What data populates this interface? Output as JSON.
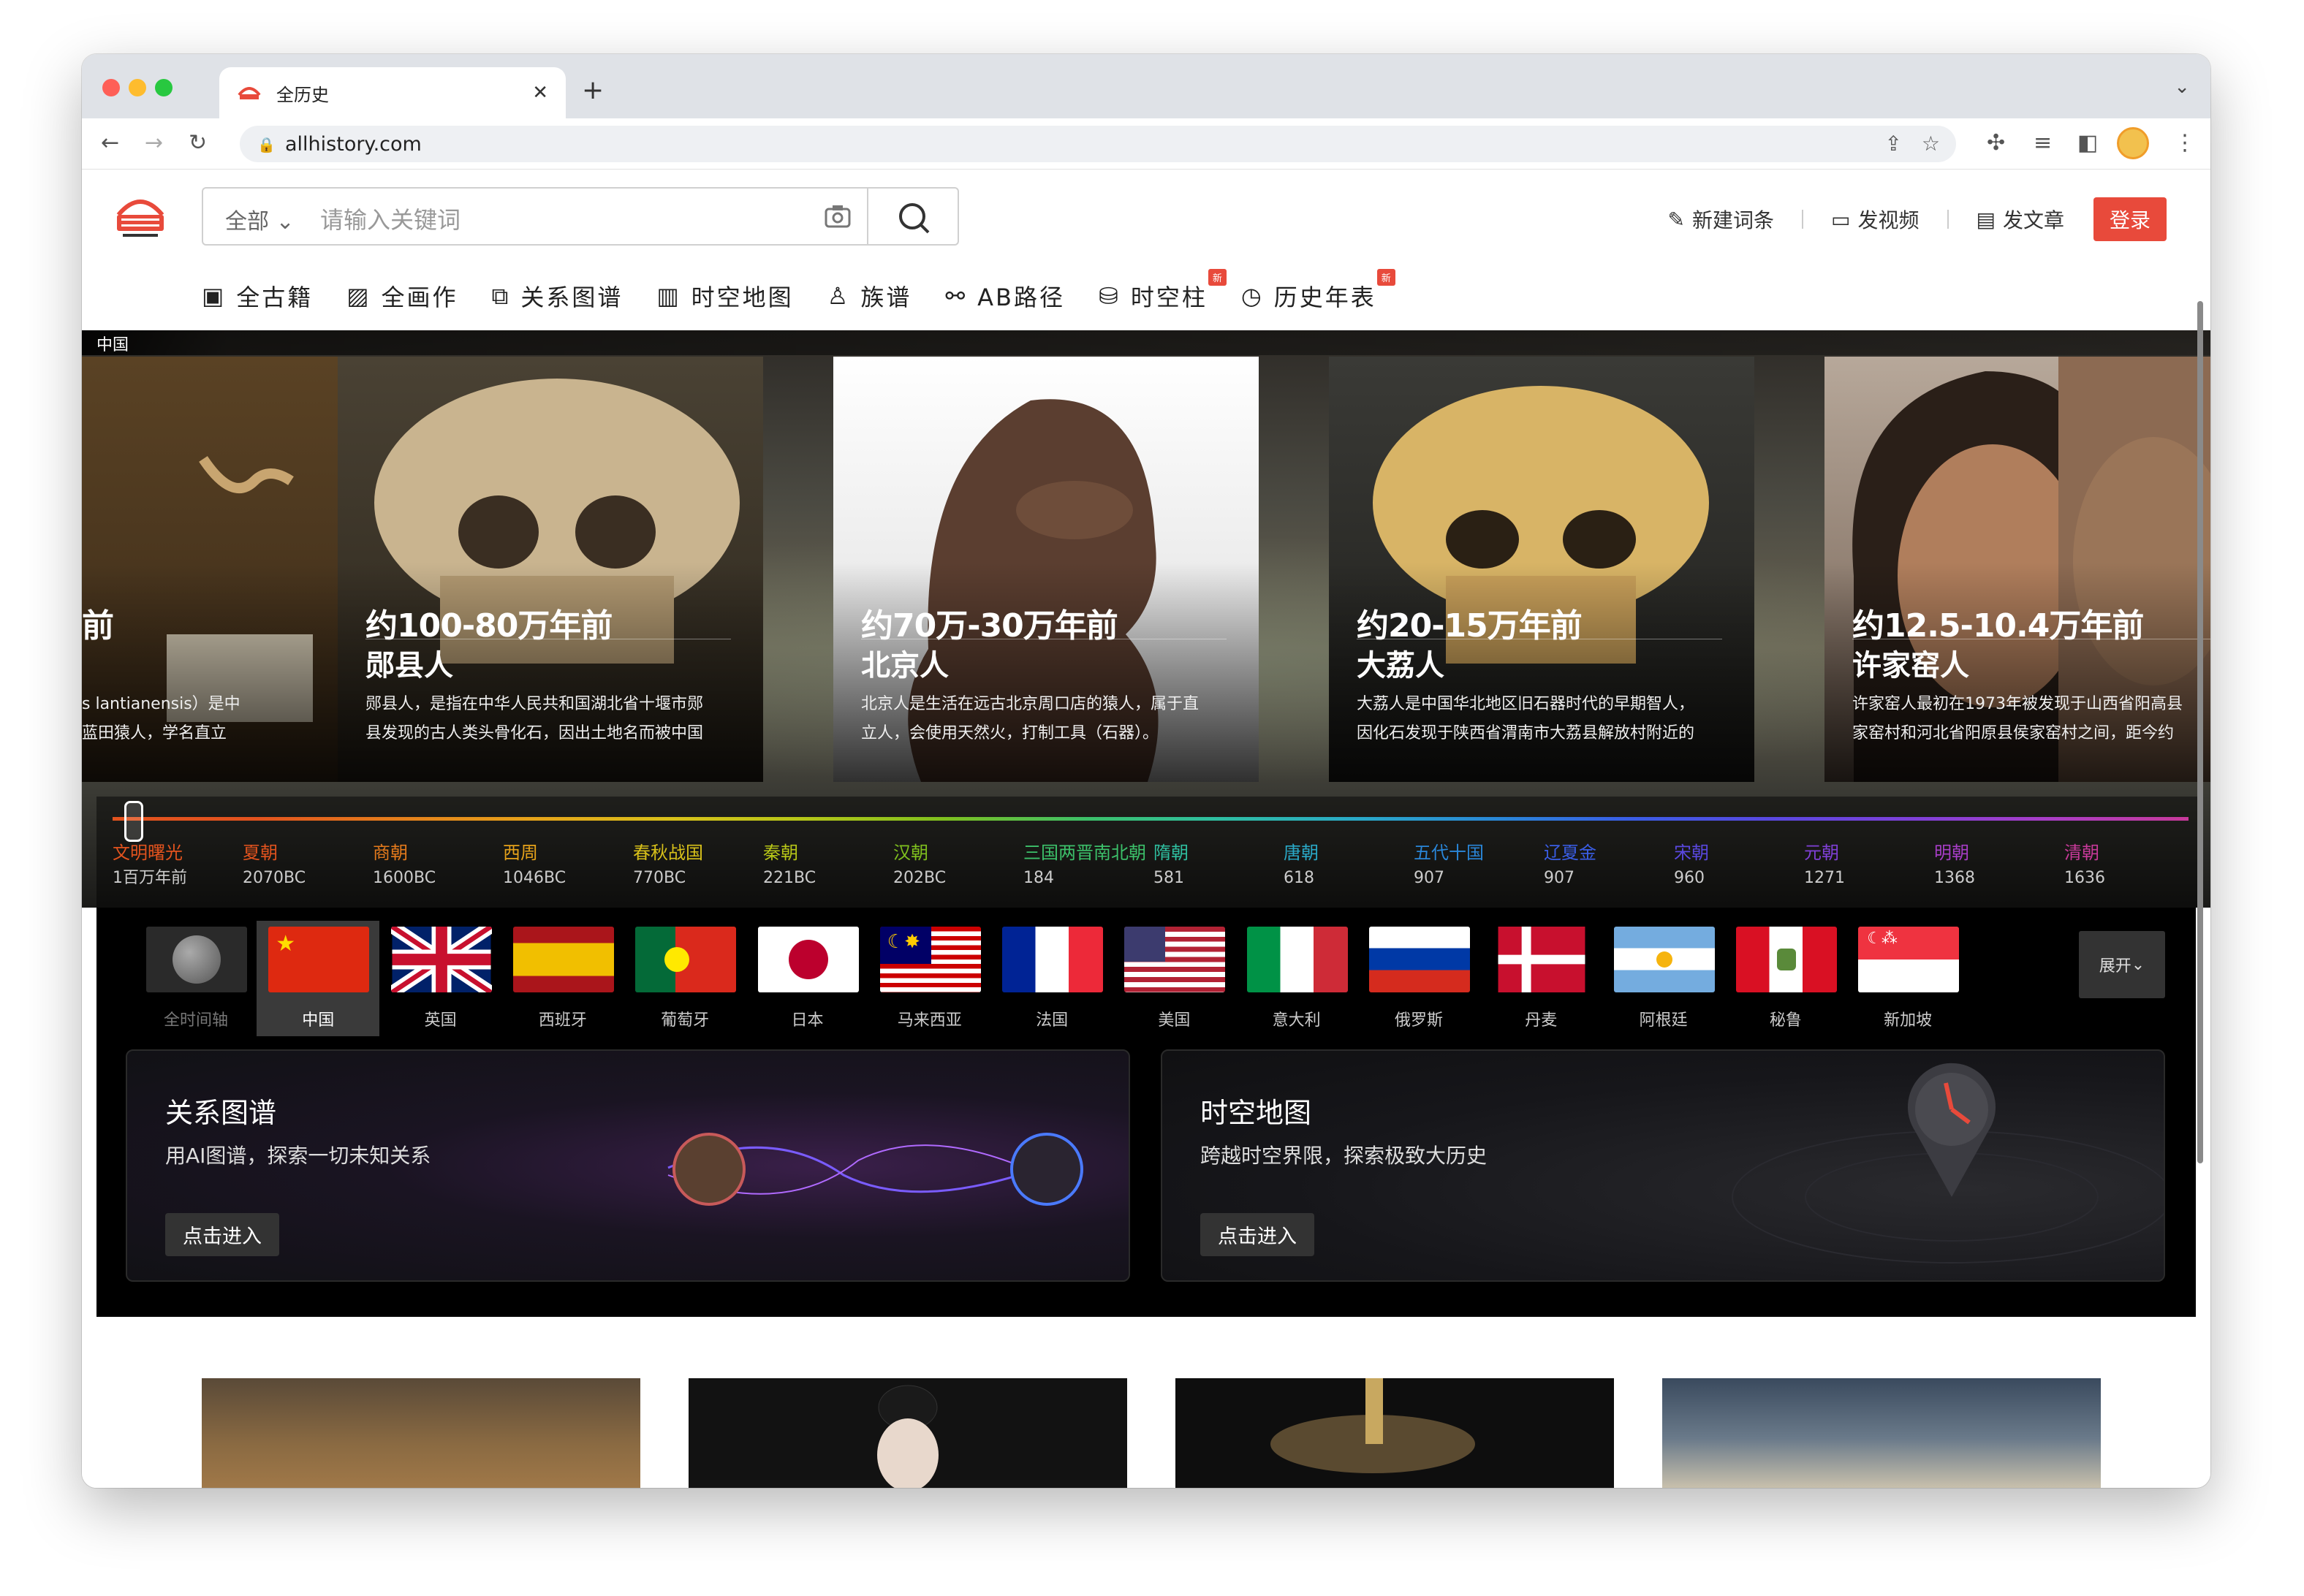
{
  "browser": {
    "tab_title": "全历史",
    "tab_close": "✕",
    "new_tab": "+",
    "url": "allhistory.com"
  },
  "header": {
    "search_scope": "全部",
    "search_placeholder": "请输入关键词",
    "actions": [
      {
        "label": "新建词条",
        "icon": "edit-icon"
      },
      {
        "label": "发视频",
        "icon": "video-icon"
      },
      {
        "label": "发文章",
        "icon": "article-icon"
      }
    ],
    "login": "登录"
  },
  "subnav": [
    {
      "label": "全古籍",
      "icon": "book-icon",
      "badge": ""
    },
    {
      "label": "全画作",
      "icon": "painting-icon",
      "badge": ""
    },
    {
      "label": "关系图谱",
      "icon": "graph-icon",
      "badge": ""
    },
    {
      "label": "时空地图",
      "icon": "map-icon",
      "badge": ""
    },
    {
      "label": "族谱",
      "icon": "family-icon",
      "badge": ""
    },
    {
      "label": "AB路径",
      "icon": "path-icon",
      "badge": ""
    },
    {
      "label": "时空柱",
      "icon": "pillar-icon",
      "badge": "新"
    },
    {
      "label": "历史年表",
      "icon": "timeline-icon",
      "badge": "新"
    }
  ],
  "hero": {
    "country_label": "中国",
    "cards": [
      {
        "era": "前",
        "name": "",
        "desc": [
          "s lantianensis）是中",
          "蓝田猿人，学名直立"
        ]
      },
      {
        "era": "约100-80万年前",
        "name": "郧县人",
        "desc": [
          "郧县人，是指在中华人民共和国湖北省十堰市郧",
          "县发现的古人类头骨化石，因出土地名而被中国"
        ]
      },
      {
        "era": "约70万-30万年前",
        "name": "北京人",
        "desc": [
          "北京人是生活在远古北京周口店的猿人，属于直",
          "立人，会使用天然火，打制工具（石器）。"
        ]
      },
      {
        "era": "约20-15万年前",
        "name": "大荔人",
        "desc": [
          "大荔人是中国华北地区旧石器时代的早期智人，",
          "因化石发现于陕西省渭南市大荔县解放村附近的"
        ]
      },
      {
        "era": "约12.5-10.4万年前",
        "name": "许家窑人",
        "desc": [
          "许家窑人最初在1973年被发现于山西省阳高县",
          "家窑村和河北省阳原县侯家窑村之间，距今约"
        ]
      }
    ]
  },
  "timeline": [
    {
      "name": "文明曙光",
      "year": "1百万年前",
      "color": "#e2531e"
    },
    {
      "name": "夏朝",
      "year": "2070BC",
      "color": "#e2531e"
    },
    {
      "name": "商朝",
      "year": "1600BC",
      "color": "#e47a1c"
    },
    {
      "name": "西周",
      "year": "1046BC",
      "color": "#e6a21a"
    },
    {
      "name": "春秋战国",
      "year": "770BC",
      "color": "#d8c11a"
    },
    {
      "name": "秦朝",
      "year": "221BC",
      "color": "#b7c618"
    },
    {
      "name": "汉朝",
      "year": "202BC",
      "color": "#7fc01e"
    },
    {
      "name": "三国两晋南北朝",
      "year": "184",
      "color": "#3cc06a"
    },
    {
      "name": "隋朝",
      "year": "581",
      "color": "#2fbfa0"
    },
    {
      "name": "唐朝",
      "year": "618",
      "color": "#2aa9c8"
    },
    {
      "name": "五代十国",
      "year": "907",
      "color": "#2a86d8"
    },
    {
      "name": "辽夏金",
      "year": "907",
      "color": "#3a5ee6"
    },
    {
      "name": "宋朝",
      "year": "960",
      "color": "#5a48e0"
    },
    {
      "name": "元朝",
      "year": "1271",
      "color": "#8040d8"
    },
    {
      "name": "明朝",
      "year": "1368",
      "color": "#a83ec8"
    },
    {
      "name": "清朝",
      "year": "1636",
      "color": "#c83a9a"
    }
  ],
  "countries": {
    "items": [
      "全时间轴",
      "中国",
      "英国",
      "西班牙",
      "葡萄牙",
      "日本",
      "马来西亚",
      "法国",
      "美国",
      "意大利",
      "俄罗斯",
      "丹麦",
      "阿根廷",
      "秘鲁",
      "新加坡"
    ],
    "selected": "中国",
    "expand": "展开"
  },
  "panels": [
    {
      "title": "关系图谱",
      "subtitle": "用AI图谱，探索一切未知关系",
      "button": "点击进入"
    },
    {
      "title": "时空地图",
      "subtitle": "跨越时空界限，探索极致大历史",
      "button": "点击进入"
    }
  ],
  "colors": {
    "brand": "#e84a3b",
    "dark": "#000000"
  }
}
